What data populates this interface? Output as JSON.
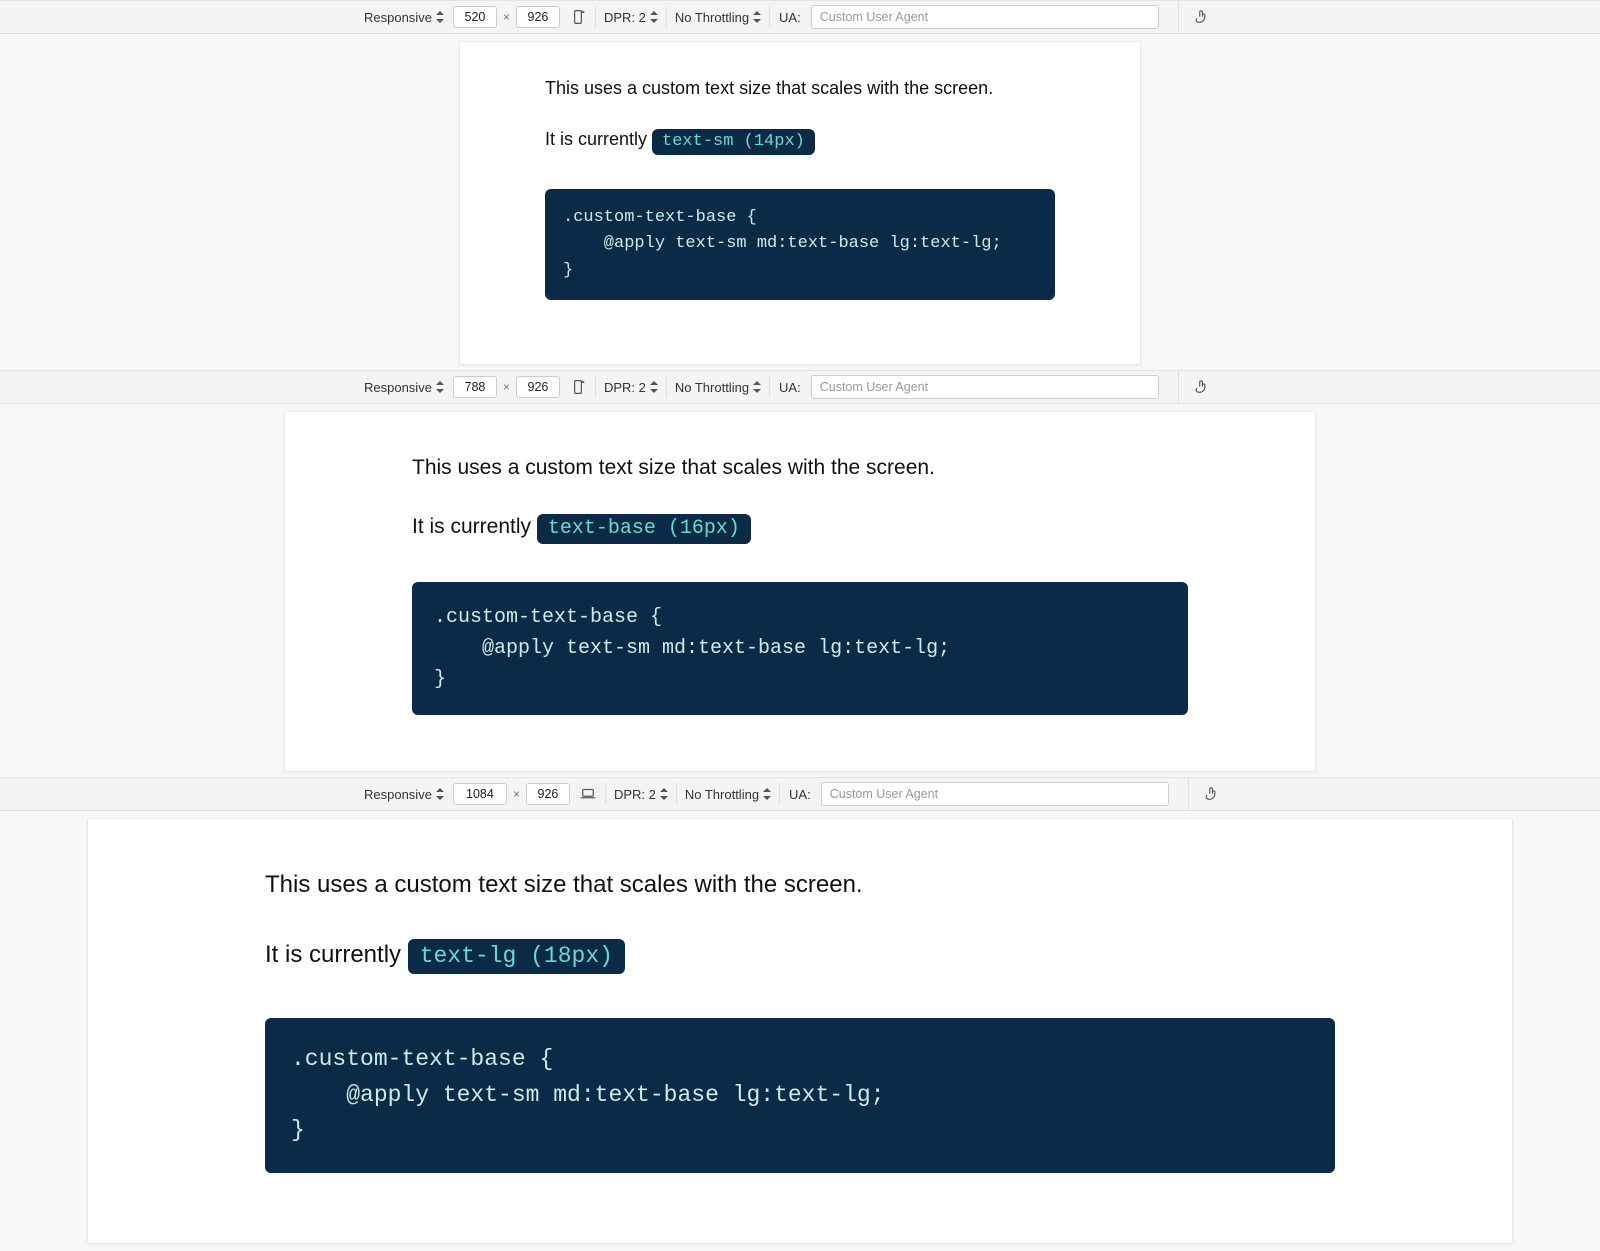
{
  "sections": [
    {
      "toolbar": {
        "mode_label": "Responsive",
        "width": "520",
        "height": "926",
        "dpr_label": "DPR: 2",
        "throttling_label": "No Throttling",
        "ua_label": "UA:",
        "ua_placeholder": "Custom User Agent",
        "device_icon": "phone-portrait"
      },
      "content": {
        "line1": "This uses a custom text size that scales with the screen.",
        "line2_prefix": "It is currently ",
        "badge_text": "text-sm (14px)",
        "code": ".custom-text-base {\n    @apply text-sm md:text-base lg:text-lg;\n}"
      }
    },
    {
      "toolbar": {
        "mode_label": "Responsive",
        "width": "788",
        "height": "926",
        "dpr_label": "DPR: 2",
        "throttling_label": "No Throttling",
        "ua_label": "UA:",
        "ua_placeholder": "Custom User Agent",
        "device_icon": "phone-portrait"
      },
      "content": {
        "line1": "This uses a custom text size that scales with the screen.",
        "line2_prefix": "It is currently ",
        "badge_text": "text-base (16px)",
        "code": ".custom-text-base {\n    @apply text-sm md:text-base lg:text-lg;\n}"
      }
    },
    {
      "toolbar": {
        "mode_label": "Responsive",
        "width": "1084",
        "height": "926",
        "dpr_label": "DPR: 2",
        "throttling_label": "No Throttling",
        "ua_label": "UA:",
        "ua_placeholder": "Custom User Agent",
        "device_icon": "laptop"
      },
      "content": {
        "line1": "This uses a custom text size that scales with the screen.",
        "line2_prefix": "It is currently ",
        "badge_text": "text-lg (18px)",
        "code": ".custom-text-base {\n    @apply text-sm md:text-base lg:text-lg;\n}"
      }
    }
  ]
}
